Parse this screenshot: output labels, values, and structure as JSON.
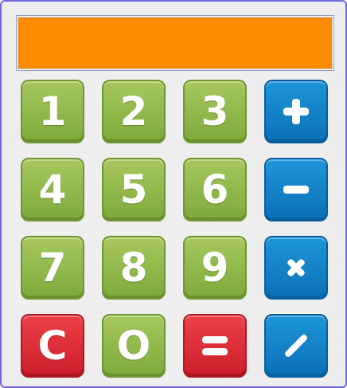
{
  "display": {
    "value": ""
  },
  "keys": {
    "one": "1",
    "two": "2",
    "three": "3",
    "four": "4",
    "five": "5",
    "six": "6",
    "seven": "7",
    "eight": "8",
    "nine": "9",
    "zero": "O",
    "clear": "C"
  },
  "icons": {
    "add": "plus-icon",
    "subtract": "minus-icon",
    "multiply": "times-icon",
    "divide": "divide-slash-icon",
    "equals": "equals-icon"
  },
  "colors": {
    "display_bg": "#ff8c00",
    "digit_key": "#8fb84a",
    "operator_key": "#1282c8",
    "action_key": "#dd2f37",
    "window_border": "#7068e0",
    "background": "#eeeeee"
  }
}
